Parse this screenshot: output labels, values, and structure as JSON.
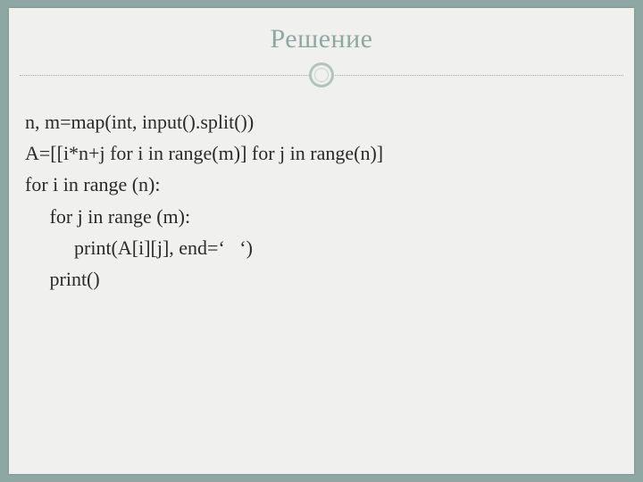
{
  "title": "Решение",
  "code": {
    "l1": "n, m=map(int, input().split())",
    "l2": "A=[[i*n+j for i in range(m)] for j in range(n)]",
    "l3": "for i in range (n):",
    "l4": "     for j in range (m):",
    "l5": "          print(A[i][j], end=‘   ‘)",
    "l6": "     print()"
  }
}
